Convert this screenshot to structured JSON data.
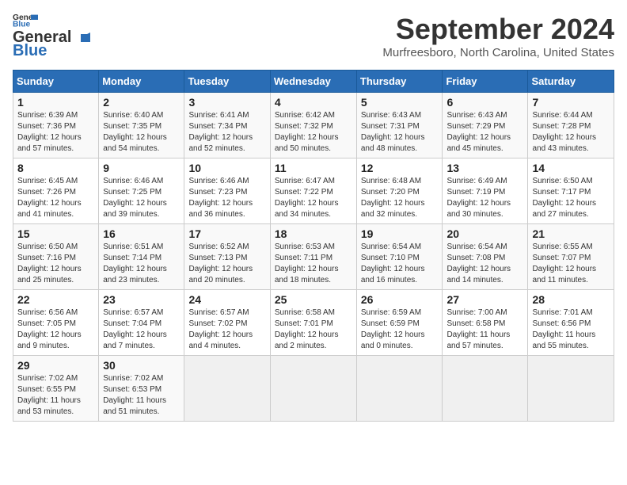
{
  "logo": {
    "line1": "General",
    "line2": "Blue"
  },
  "title": "September 2024",
  "location": "Murfreesboro, North Carolina, United States",
  "days_of_week": [
    "Sunday",
    "Monday",
    "Tuesday",
    "Wednesday",
    "Thursday",
    "Friday",
    "Saturday"
  ],
  "weeks": [
    [
      {
        "day": "1",
        "info": "Sunrise: 6:39 AM\nSunset: 7:36 PM\nDaylight: 12 hours\nand 57 minutes."
      },
      {
        "day": "2",
        "info": "Sunrise: 6:40 AM\nSunset: 7:35 PM\nDaylight: 12 hours\nand 54 minutes."
      },
      {
        "day": "3",
        "info": "Sunrise: 6:41 AM\nSunset: 7:34 PM\nDaylight: 12 hours\nand 52 minutes."
      },
      {
        "day": "4",
        "info": "Sunrise: 6:42 AM\nSunset: 7:32 PM\nDaylight: 12 hours\nand 50 minutes."
      },
      {
        "day": "5",
        "info": "Sunrise: 6:43 AM\nSunset: 7:31 PM\nDaylight: 12 hours\nand 48 minutes."
      },
      {
        "day": "6",
        "info": "Sunrise: 6:43 AM\nSunset: 7:29 PM\nDaylight: 12 hours\nand 45 minutes."
      },
      {
        "day": "7",
        "info": "Sunrise: 6:44 AM\nSunset: 7:28 PM\nDaylight: 12 hours\nand 43 minutes."
      }
    ],
    [
      {
        "day": "8",
        "info": "Sunrise: 6:45 AM\nSunset: 7:26 PM\nDaylight: 12 hours\nand 41 minutes."
      },
      {
        "day": "9",
        "info": "Sunrise: 6:46 AM\nSunset: 7:25 PM\nDaylight: 12 hours\nand 39 minutes."
      },
      {
        "day": "10",
        "info": "Sunrise: 6:46 AM\nSunset: 7:23 PM\nDaylight: 12 hours\nand 36 minutes."
      },
      {
        "day": "11",
        "info": "Sunrise: 6:47 AM\nSunset: 7:22 PM\nDaylight: 12 hours\nand 34 minutes."
      },
      {
        "day": "12",
        "info": "Sunrise: 6:48 AM\nSunset: 7:20 PM\nDaylight: 12 hours\nand 32 minutes."
      },
      {
        "day": "13",
        "info": "Sunrise: 6:49 AM\nSunset: 7:19 PM\nDaylight: 12 hours\nand 30 minutes."
      },
      {
        "day": "14",
        "info": "Sunrise: 6:50 AM\nSunset: 7:17 PM\nDaylight: 12 hours\nand 27 minutes."
      }
    ],
    [
      {
        "day": "15",
        "info": "Sunrise: 6:50 AM\nSunset: 7:16 PM\nDaylight: 12 hours\nand 25 minutes."
      },
      {
        "day": "16",
        "info": "Sunrise: 6:51 AM\nSunset: 7:14 PM\nDaylight: 12 hours\nand 23 minutes."
      },
      {
        "day": "17",
        "info": "Sunrise: 6:52 AM\nSunset: 7:13 PM\nDaylight: 12 hours\nand 20 minutes."
      },
      {
        "day": "18",
        "info": "Sunrise: 6:53 AM\nSunset: 7:11 PM\nDaylight: 12 hours\nand 18 minutes."
      },
      {
        "day": "19",
        "info": "Sunrise: 6:54 AM\nSunset: 7:10 PM\nDaylight: 12 hours\nand 16 minutes."
      },
      {
        "day": "20",
        "info": "Sunrise: 6:54 AM\nSunset: 7:08 PM\nDaylight: 12 hours\nand 14 minutes."
      },
      {
        "day": "21",
        "info": "Sunrise: 6:55 AM\nSunset: 7:07 PM\nDaylight: 12 hours\nand 11 minutes."
      }
    ],
    [
      {
        "day": "22",
        "info": "Sunrise: 6:56 AM\nSunset: 7:05 PM\nDaylight: 12 hours\nand 9 minutes."
      },
      {
        "day": "23",
        "info": "Sunrise: 6:57 AM\nSunset: 7:04 PM\nDaylight: 12 hours\nand 7 minutes."
      },
      {
        "day": "24",
        "info": "Sunrise: 6:57 AM\nSunset: 7:02 PM\nDaylight: 12 hours\nand 4 minutes."
      },
      {
        "day": "25",
        "info": "Sunrise: 6:58 AM\nSunset: 7:01 PM\nDaylight: 12 hours\nand 2 minutes."
      },
      {
        "day": "26",
        "info": "Sunrise: 6:59 AM\nSunset: 6:59 PM\nDaylight: 12 hours\nand 0 minutes."
      },
      {
        "day": "27",
        "info": "Sunrise: 7:00 AM\nSunset: 6:58 PM\nDaylight: 11 hours\nand 57 minutes."
      },
      {
        "day": "28",
        "info": "Sunrise: 7:01 AM\nSunset: 6:56 PM\nDaylight: 11 hours\nand 55 minutes."
      }
    ],
    [
      {
        "day": "29",
        "info": "Sunrise: 7:02 AM\nSunset: 6:55 PM\nDaylight: 11 hours\nand 53 minutes."
      },
      {
        "day": "30",
        "info": "Sunrise: 7:02 AM\nSunset: 6:53 PM\nDaylight: 11 hours\nand 51 minutes."
      },
      {
        "day": "",
        "info": ""
      },
      {
        "day": "",
        "info": ""
      },
      {
        "day": "",
        "info": ""
      },
      {
        "day": "",
        "info": ""
      },
      {
        "day": "",
        "info": ""
      }
    ]
  ]
}
